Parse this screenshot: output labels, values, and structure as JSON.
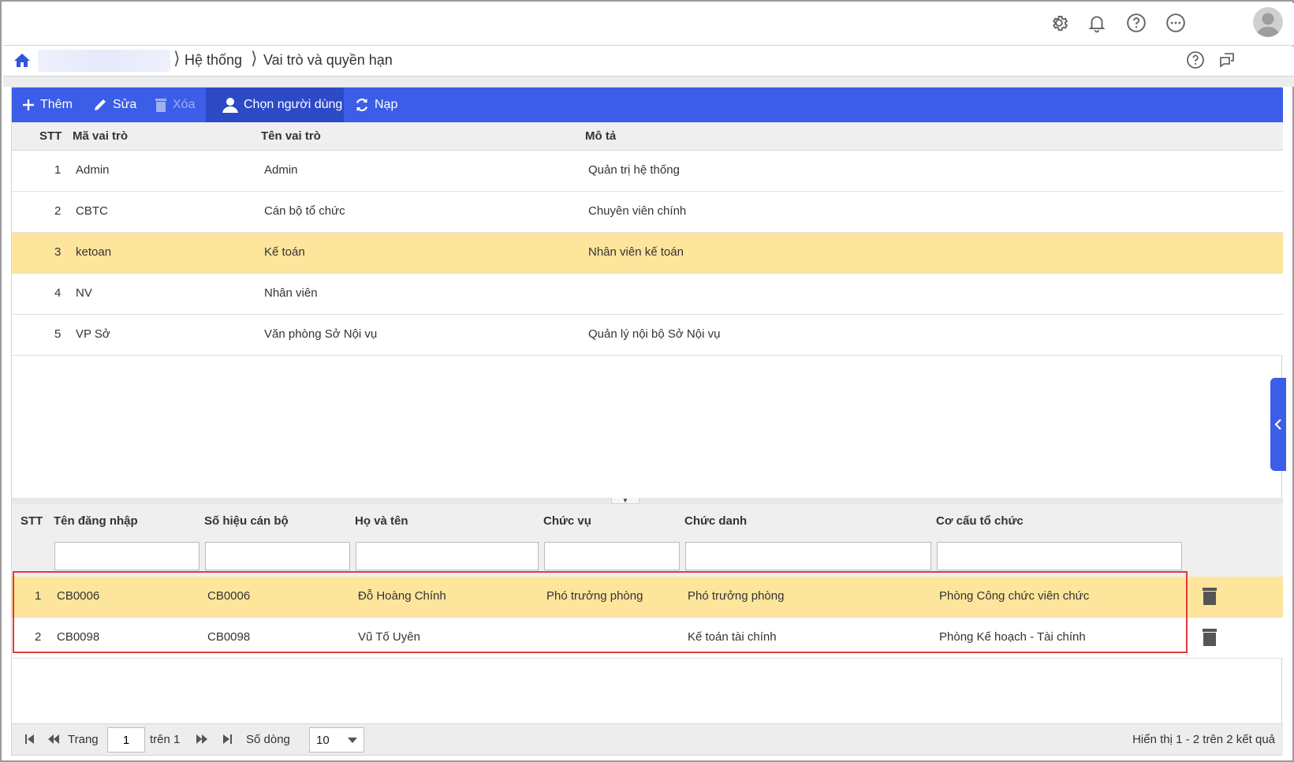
{
  "breadcrumb": {
    "items": [
      "Hệ thống",
      "Vai trò và quyền hạn"
    ]
  },
  "toolbar": {
    "add_label": "Thêm",
    "edit_label": "Sửa",
    "delete_label": "Xóa",
    "choose_user_label": "Chọn người dùng",
    "reload_label": "Nạp"
  },
  "roles_table": {
    "columns": [
      "STT",
      "Mã vai trò",
      "Tên vai trò",
      "Mô tả"
    ],
    "rows": [
      {
        "stt": "1",
        "code": "Admin",
        "name": "Admin",
        "desc": "Quản trị hệ thống"
      },
      {
        "stt": "2",
        "code": "CBTC",
        "name": "Cán bộ tổ chức",
        "desc": "Chuyên viên chính"
      },
      {
        "stt": "3",
        "code": "ketoan",
        "name": "Kế toán",
        "desc": "Nhân viên kế toán"
      },
      {
        "stt": "4",
        "code": "NV",
        "name": "Nhân viên",
        "desc": ""
      },
      {
        "stt": "5",
        "code": "VP Sở",
        "name": "Văn phòng Sở Nội vụ",
        "desc": "Quản lý nội bộ Sở Nội vụ"
      }
    ],
    "selected_index": 2
  },
  "users_table": {
    "columns": [
      "STT",
      "Tên đăng nhập",
      "Số hiệu cán bộ",
      "Họ và tên",
      "Chức vụ",
      "Chức danh",
      "Cơ cấu tổ chức"
    ],
    "rows": [
      {
        "stt": "1",
        "login": "CB0006",
        "staff_no": "CB0006",
        "full_name": "Đỗ Hoàng Chính",
        "position": "Phó trưởng phòng",
        "title": "Phó trưởng phòng",
        "org": "Phòng Công chức viên chức"
      },
      {
        "stt": "2",
        "login": "CB0098",
        "staff_no": "CB0098",
        "full_name": "Vũ Tố Uyên",
        "position": "",
        "title": "Kế toán tài chính",
        "org": "Phòng Kế hoạch - Tài chính"
      }
    ],
    "selected_index": 0
  },
  "pager": {
    "page_label": "Trang",
    "page_value": "1",
    "of_label": "trên 1",
    "rows_label": "Số dòng",
    "rows_value": "10",
    "summary": "Hiển thị 1 - 2 trên 2 kết quả"
  },
  "colors": {
    "toolbar": "#3b5de7",
    "selected_row": "#fde59c",
    "highlight_box": "#e53935"
  },
  "icons": {
    "topbar": [
      "gear-icon",
      "bell-icon",
      "help-icon",
      "more-icon",
      "user-avatar-icon"
    ],
    "breadcrumb": [
      "home-icon",
      "help-icon",
      "feedback-icon"
    ]
  }
}
